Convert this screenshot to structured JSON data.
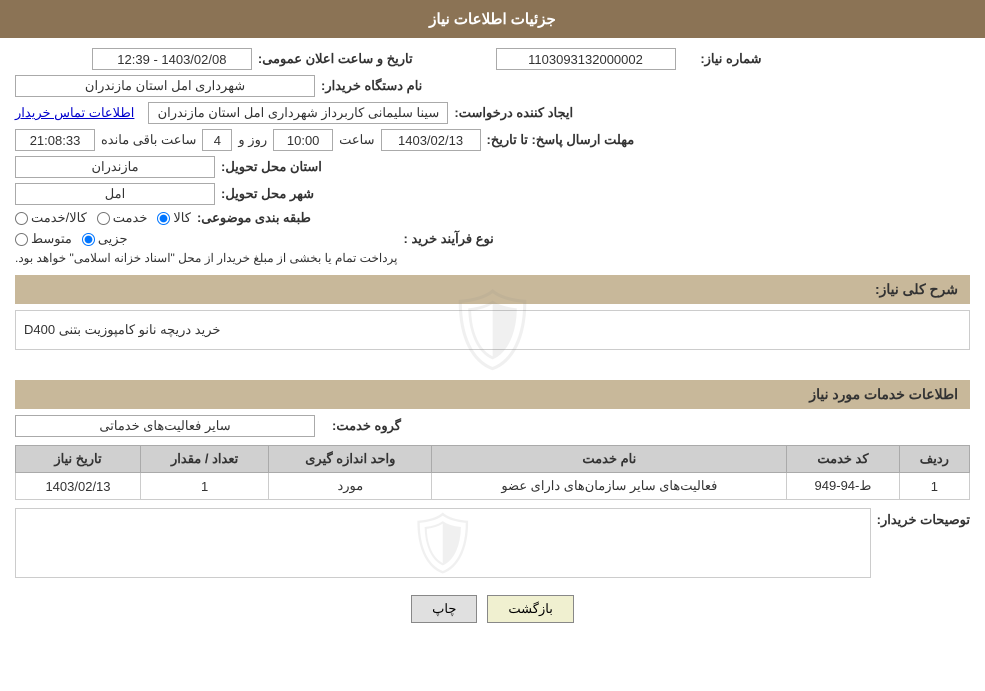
{
  "header": {
    "title": "جزئیات اطلاعات نیاز"
  },
  "fields": {
    "need_number_label": "شماره نیاز:",
    "need_number_value": "1103093132000002",
    "announce_date_label": "تاریخ و ساعت اعلان عمومی:",
    "announce_date_value": "1403/02/08 - 12:39",
    "buyer_org_label": "نام دستگاه خریدار:",
    "buyer_org_value": "شهرداری امل استان مازندران",
    "creator_label": "ایجاد کننده درخواست:",
    "creator_value": "سینا سلیمانی کاربرداز شهرداری امل استان مازندران",
    "creator_link": "اطلاعات تماس خریدار",
    "deadline_label": "مهلت ارسال پاسخ: تا تاریخ:",
    "deadline_date": "1403/02/13",
    "deadline_time_label": "ساعت",
    "deadline_time": "10:00",
    "deadline_day_label": "روز و",
    "deadline_days": "4",
    "deadline_remaining_label": "ساعت باقی مانده",
    "deadline_remaining": "21:08:33",
    "province_label": "استان محل تحویل:",
    "province_value": "مازندران",
    "city_label": "شهر محل تحویل:",
    "city_value": "امل",
    "category_label": "طبقه بندی موضوعی:",
    "category_options": [
      "کالا",
      "خدمت",
      "کالا/خدمت"
    ],
    "category_selected": "کالا",
    "process_label": "نوع فرآیند خرید :",
    "process_options": [
      "جزیی",
      "متوسط"
    ],
    "process_note": "پرداخت تمام یا بخشی از مبلغ خریدار از محل \"اسناد خزانه اسلامی\" خواهد بود.",
    "summary_section": "شرح کلی نیاز:",
    "summary_value": "خرید دریچه نانو کامپوزیت بتنی D400",
    "services_section": "اطلاعات خدمات مورد نیاز",
    "service_group_label": "گروه خدمت:",
    "service_group_value": "سایر فعالیت‌های خدماتی",
    "table": {
      "headers": [
        "ردیف",
        "کد خدمت",
        "نام خدمت",
        "واحد اندازه گیری",
        "تعداد / مقدار",
        "تاریخ نیاز"
      ],
      "rows": [
        {
          "row": "1",
          "code": "ط-94-949",
          "name": "فعالیت‌های سایر سازمان‌های دارای عضو",
          "unit": "مورد",
          "qty": "1",
          "date": "1403/02/13"
        }
      ]
    },
    "buyer_notes_label": "توصیحات خریدار:",
    "buyer_notes_value": ""
  },
  "buttons": {
    "print": "چاپ",
    "back": "بازگشت"
  }
}
